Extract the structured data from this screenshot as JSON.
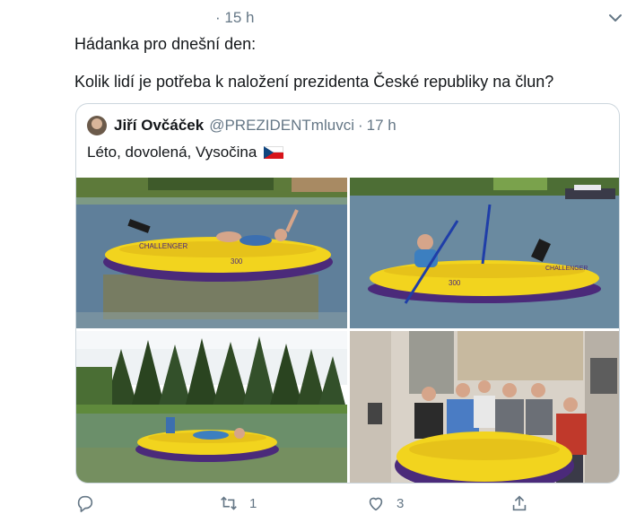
{
  "tweet": {
    "time": "· 15 h",
    "text_line1": "Hádanka pro dnešní den:",
    "text_line2": "Kolik lidí je potřeba k naložení prezidenta České republiky na člun?"
  },
  "quote": {
    "name": "Jiří Ovčáček",
    "handle": "@PREZIDENTmluvci",
    "dot": "·",
    "time": "17 h",
    "text": "Léto, dovolená, Vysočina",
    "flag_icon": "czech-flag"
  },
  "photos": [
    {
      "name": "photo-man-in-yellow-dinghy-waving"
    },
    {
      "name": "photo-man-rowing-dinghy"
    },
    {
      "name": "photo-dinghy-forest-lake"
    },
    {
      "name": "photo-group-with-dinghy"
    }
  ],
  "boat_text": {
    "brand": "CHALLENGER",
    "model": "300"
  },
  "actions": {
    "reply_count": "",
    "retweet_count": "1",
    "like_count": "3"
  },
  "colors": {
    "accent": "#1da1f2",
    "muted": "#657786",
    "boat_yellow": "#f2d41e",
    "boat_purple": "#4b2a7a"
  }
}
